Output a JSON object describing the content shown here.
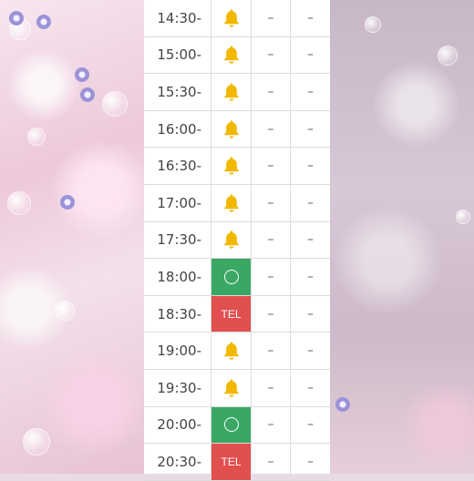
{
  "schedule": {
    "rows": [
      {
        "time": "14:30-",
        "status": "bell",
        "col2": "–",
        "col3": "–"
      },
      {
        "time": "15:00-",
        "status": "bell",
        "col2": "–",
        "col3": "–"
      },
      {
        "time": "15:30-",
        "status": "bell",
        "col2": "–",
        "col3": "–"
      },
      {
        "time": "16:00-",
        "status": "bell",
        "col2": "–",
        "col3": "–"
      },
      {
        "time": "16:30-",
        "status": "bell",
        "col2": "–",
        "col3": "–"
      },
      {
        "time": "17:00-",
        "status": "bell",
        "col2": "–",
        "col3": "–"
      },
      {
        "time": "17:30-",
        "status": "bell",
        "col2": "–",
        "col3": "–"
      },
      {
        "time": "18:00-",
        "status": "circle",
        "col2": "–",
        "col3": "–"
      },
      {
        "time": "18:30-",
        "status": "TEL",
        "col2": "–",
        "col3": "–"
      },
      {
        "time": "19:00-",
        "status": "bell",
        "col2": "–",
        "col3": "–"
      },
      {
        "time": "19:30-",
        "status": "bell",
        "col2": "–",
        "col3": "–"
      },
      {
        "time": "20:00-",
        "status": "circle",
        "col2": "–",
        "col3": "–"
      },
      {
        "time": "20:30-",
        "status": "TEL",
        "col2": "–",
        "col3": "–"
      }
    ]
  },
  "colors": {
    "available": "#3aa864",
    "phone": "#e14f4f",
    "bell": "#f2b800"
  },
  "icons": {
    "bell": "bell-icon",
    "circle": "available-circle-icon"
  }
}
